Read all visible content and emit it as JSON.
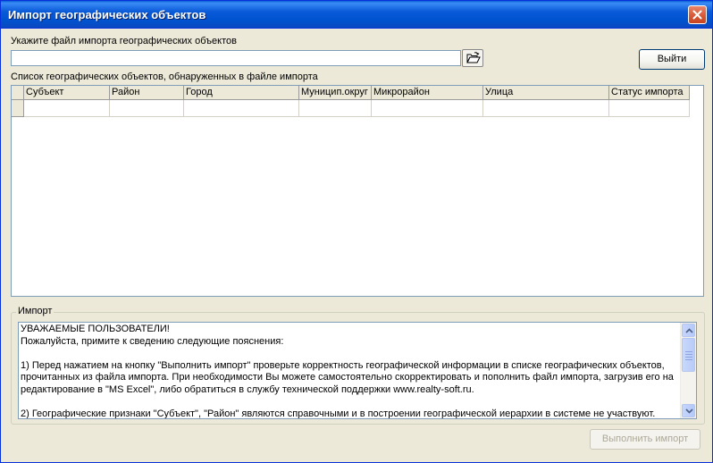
{
  "window": {
    "title": "Импорт географических объектов"
  },
  "file_section": {
    "label": "Укажите файл импорта географических объектов",
    "input_value": "",
    "browse_icon": "open-folder-icon"
  },
  "exit_button": "Выйти",
  "list_section": {
    "label": "Список географических объектов, обнаруженных в файле импорта",
    "columns": [
      "Субъект",
      "Район",
      "Город",
      "Муницип.округ",
      "Микрорайон",
      "Улица",
      "Статус импорта"
    ],
    "rows": [
      [
        "",
        "",
        "",
        "",
        "",
        "",
        ""
      ]
    ]
  },
  "import_group": {
    "title": "Импорт",
    "memo_lines": [
      "УВАЖАЕМЫЕ ПОЛЬЗОВАТЕЛИ!",
      "Пожалуйста, примите к сведению следующие пояснения:",
      "",
      "1) Перед нажатием на кнопку \"Выполнить импорт\" проверьте корректность географической информации в списке географических объектов,",
      "прочитанных из файла импорта. При необходимости Вы можете самостоятельно скорректировать и пополнить файл импорта, загрузив его на",
      "редактирование в \"MS Excel\", либо обратиться в службу технической поддержки www.realty-soft.ru.",
      "",
      "2) Географические признаки \"Субъект\", \"Район\" являются справочными и в построении географической иерархии в системе не участвуют."
    ]
  },
  "run_import_button": "Выполнить импорт"
}
